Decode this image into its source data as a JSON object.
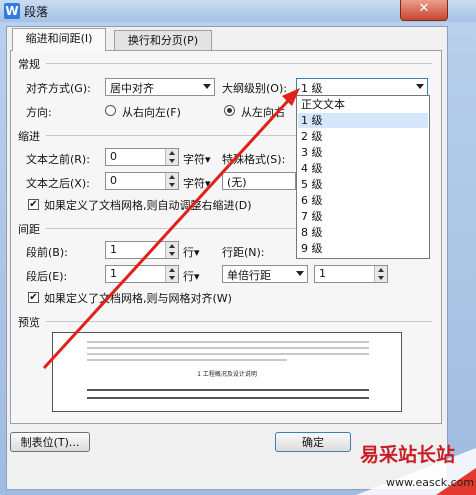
{
  "window": {
    "title": "段落",
    "app_icon_letter": "W",
    "close_glyph": "✕"
  },
  "tabs": [
    {
      "label": "缩进和间距(I)",
      "active": true
    },
    {
      "label": "换行和分页(P)",
      "active": false
    }
  ],
  "general": {
    "section_label": "常规",
    "alignment_label": "对齐方式(G):",
    "alignment_value": "居中对齐",
    "outline_label": "大纲级别(O):",
    "outline_value": "1 级",
    "direction_label": "方向:",
    "rtl_label": "从右向左(F)",
    "ltr_label": "从左向右"
  },
  "indent": {
    "section_label": "缩进",
    "before_label": "文本之前(R):",
    "before_value": "0",
    "before_unit": "字符▾",
    "after_label": "文本之后(X):",
    "after_value": "0",
    "after_unit": "字符▾",
    "special_label": "特殊格式(S):",
    "special_value": "(无)",
    "grid_check_label": "如果定义了文档网格,则自动调整右缩进(D)"
  },
  "outline_dropdown": {
    "items": [
      "正文文本",
      "1 级",
      "2 级",
      "3 级",
      "4 级",
      "5 级",
      "6 级",
      "7 级",
      "8 级",
      "9 级"
    ],
    "selected_index": 1
  },
  "spacing": {
    "section_label": "间距",
    "before_label": "段前(B):",
    "before_value": "1",
    "before_unit": "行▾",
    "after_label": "段后(E):",
    "after_value": "1",
    "after_unit": "行▾",
    "line_label": "行距(N):",
    "line_value": "单倍行距",
    "at_value": "1",
    "grid_check_label": "如果定义了文档网格,则与网格对齐(W)"
  },
  "preview": {
    "section_label": "预览",
    "sample_text": "1 工程概况及设计说明"
  },
  "buttons": {
    "tabs_label": "制表位(T)...",
    "ok_label": "确定"
  },
  "watermark": {
    "text": "易采站长站",
    "url": "www.easck.com"
  },
  "colors": {
    "annotation_arrow": "#e0201b",
    "selection": "#d7e7fb"
  }
}
